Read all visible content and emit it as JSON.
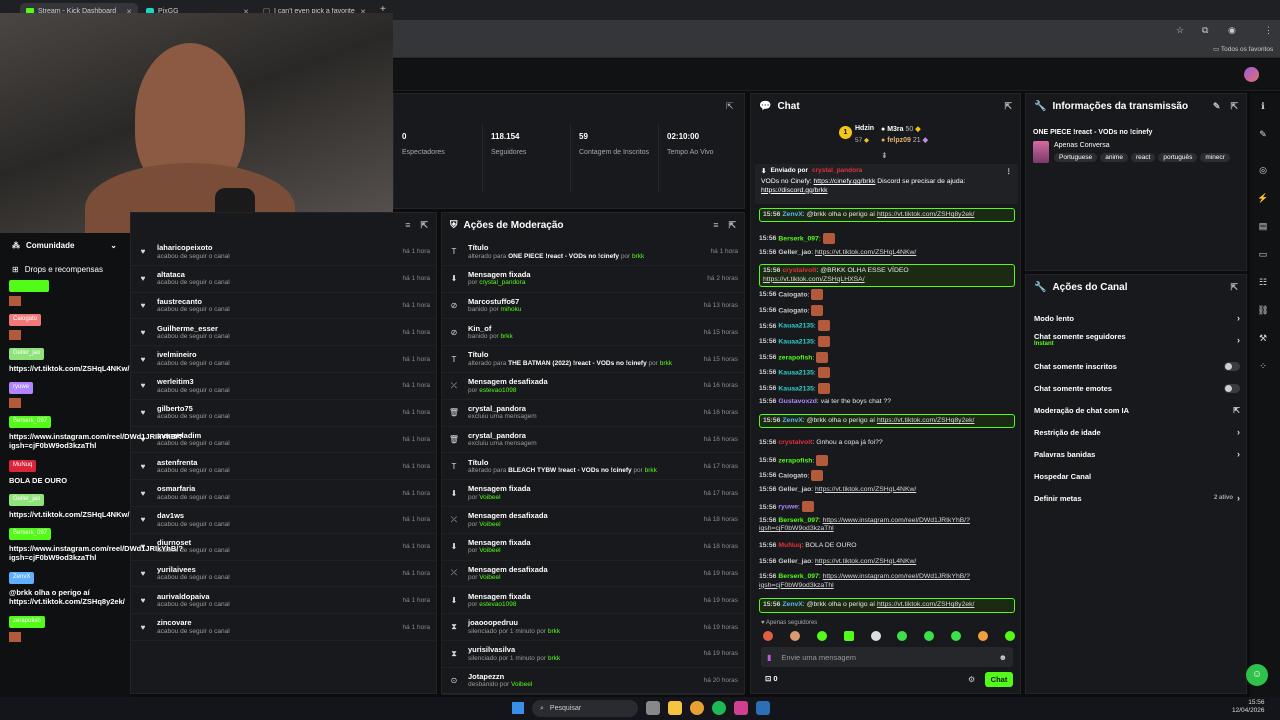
{
  "browser": {
    "tabs": [
      {
        "label": "Stream - Kick Dashboard",
        "active": true
      },
      {
        "label": "PixGG",
        "active": false
      },
      {
        "label": "I can't even pick a favorite her...",
        "active": false
      }
    ],
    "bookmarks_label": "Todos os favoritos"
  },
  "stats": [
    {
      "value": "0",
      "label": "Espectadores"
    },
    {
      "value": "118.154",
      "label": "Seguidores"
    },
    {
      "value": "59",
      "label": "Contagem de Inscritos"
    },
    {
      "value": "02:10:00",
      "label": "Tempo Ao Vivo"
    }
  ],
  "community": {
    "title": "Comunidade",
    "drops_label": "Drops e recompensas"
  },
  "followers": [
    {
      "name": "laharicopeixoto",
      "sub": "acabou de seguir o canal",
      "time": "há 1 hora"
    },
    {
      "name": "altataca",
      "sub": "acabou de seguir o canal",
      "time": "há 1 hora"
    },
    {
      "name": "faustrecanto",
      "sub": "acabou de seguir o canal",
      "time": "há 1 hora"
    },
    {
      "name": "Guilherme_esser",
      "sub": "acabou de seguir o canal",
      "time": "há 1 hora"
    },
    {
      "name": "ivelmineiro",
      "sub": "acabou de seguir o canal",
      "time": "há 1 hora"
    },
    {
      "name": "werleitim3",
      "sub": "acabou de seguir o canal",
      "time": "há 1 hora"
    },
    {
      "name": "gilberto75",
      "sub": "acabou de seguir o canal",
      "time": "há 1 hora"
    },
    {
      "name": "marmeladim",
      "sub": "acabou de seguir o canal",
      "time": "há 1 hora"
    },
    {
      "name": "astenfrenta",
      "sub": "acabou de seguir o canal",
      "time": "há 1 hora"
    },
    {
      "name": "osmarfaria",
      "sub": "acabou de seguir o canal",
      "time": "há 1 hora"
    },
    {
      "name": "dav1ws",
      "sub": "acabou de seguir o canal",
      "time": "há 1 hora"
    },
    {
      "name": "diurnoset",
      "sub": "acabou de seguir o canal",
      "time": "há 1 hora"
    },
    {
      "name": "yurilaivees",
      "sub": "acabou de seguir o canal",
      "time": "há 1 hora"
    },
    {
      "name": "aurivaldopaiva",
      "sub": "acabou de seguir o canal",
      "time": "há 1 hora"
    },
    {
      "name": "zincovare",
      "sub": "acabou de seguir o canal",
      "time": "há 1 hora"
    }
  ],
  "moderation": {
    "title": "Ações de Moderação",
    "rows": [
      {
        "icon": "T",
        "name": "Título",
        "pre": "alterado para ",
        "bold": "ONE PIECE !react - VODs no !cinefy",
        "by": "brkk",
        "time": "há 1 hora"
      },
      {
        "icon": "⬇",
        "name": "Mensagem fixada",
        "pre": "por ",
        "bold": "",
        "by": "crystal_pandora",
        "time": "há 2 horas"
      },
      {
        "icon": "⊘",
        "name": "Marcostuffo67",
        "pre": "banido por ",
        "bold": "",
        "by": "mihoku",
        "time": "há 13 horas"
      },
      {
        "icon": "⊘",
        "name": "Kin_of",
        "pre": "banido por ",
        "bold": "",
        "by": "brkk",
        "time": "há 15 horas"
      },
      {
        "icon": "T",
        "name": "Título",
        "pre": "alterado para ",
        "bold": "THE BATMAN (2022) !react - VODs no !cinefy",
        "by": "brkk",
        "time": "há 15 horas"
      },
      {
        "icon": "⤫",
        "name": "Mensagem desafixada",
        "pre": "por ",
        "bold": "",
        "by": "estevao1098",
        "time": "há 16 horas"
      },
      {
        "icon": "🗑",
        "name": "crystal_pandora",
        "pre": "excluiu uma mensagem",
        "bold": "",
        "by": "",
        "time": "há 16 horas"
      },
      {
        "icon": "🗑",
        "name": "crystal_pandora",
        "pre": "excluiu uma mensagem",
        "bold": "",
        "by": "",
        "time": "há 16 horas"
      },
      {
        "icon": "T",
        "name": "Título",
        "pre": "alterado para ",
        "bold": "BLEACH TYBW !react - VODs no !cinefy",
        "by": "brkk",
        "time": "há 17 horas"
      },
      {
        "icon": "⬇",
        "name": "Mensagem fixada",
        "pre": "por ",
        "bold": "",
        "by": "Voibeel",
        "time": "há 17 horas"
      },
      {
        "icon": "⤫",
        "name": "Mensagem desafixada",
        "pre": "por ",
        "bold": "",
        "by": "Voibeel",
        "time": "há 18 horas"
      },
      {
        "icon": "⬇",
        "name": "Mensagem fixada",
        "pre": "por ",
        "bold": "",
        "by": "Voibeel",
        "time": "há 18 horas"
      },
      {
        "icon": "⤫",
        "name": "Mensagem desafixada",
        "pre": "por ",
        "bold": "",
        "by": "Voibeel",
        "time": "há 19 horas"
      },
      {
        "icon": "⬇",
        "name": "Mensagem fixada",
        "pre": "por ",
        "bold": "",
        "by": "estevao1098",
        "time": "há 19 horas"
      },
      {
        "icon": "⧗",
        "name": "joaooopedruu",
        "pre": "silenciado por 1 minuto por ",
        "bold": "",
        "by": "brkk",
        "time": "há 19 horas"
      },
      {
        "icon": "⧗",
        "name": "yurisilvasilva",
        "pre": "silenciado por 1 minuto por ",
        "bold": "",
        "by": "brkk",
        "time": "há 19 horas"
      },
      {
        "icon": "⊙",
        "name": "Jotapezzn",
        "pre": "desbanido por ",
        "bold": "",
        "by": "Voibeel",
        "time": "há 20 horas"
      }
    ]
  },
  "chat": {
    "title": "Chat",
    "leaderboard": [
      {
        "name": "Hdzin",
        "points": "57"
      },
      {
        "name": "M3ra",
        "points": "50"
      },
      {
        "name": "felpz09",
        "points": "21"
      }
    ],
    "pinned": {
      "label": "Enviado por",
      "user": "crystal_pandora",
      "text": "VODs no Cinefy: ",
      "link1": "https://cinefy.gg/brkk",
      "text2": " Discord se precisar de ajuda: ",
      "link2": "https://discord.gg/brkk"
    },
    "messages": [
      {
        "time": "15:56",
        "user": "ZenvX",
        "color": "#5fb0ff",
        "text": "@brkk olha o perigo aí ",
        "link": "https://vt.tiktok.com/ZSHq8y2ek/",
        "hl": true
      },
      {
        "time": "15:56",
        "user": "Berserk_097",
        "color": "#53fc18",
        "text": "",
        "link": "",
        "hl": false
      },
      {
        "time": "15:56",
        "user": "Geller_jao",
        "color": "#cfcfcf",
        "text": "",
        "link": "https://vt.tiktok.com/ZSHqL4NKw/",
        "hl": false
      },
      {
        "time": "15:56",
        "user": "crystalvolt",
        "color": "#e0303a",
        "text": "@BRKK OLHA ESSE VÍDEO ",
        "link": "https://vt.tiktok.com/ZSHqLHXSA/",
        "hl": true
      },
      {
        "time": "15:56",
        "user": "Caiogato",
        "color": "#cfcfcf",
        "text": "",
        "link": "",
        "hl": false
      },
      {
        "time": "15:56",
        "user": "Caiogato",
        "color": "#cfcfcf",
        "text": "",
        "link": "",
        "hl": false
      },
      {
        "time": "15:56",
        "user": "Kauaa2135",
        "color": "#2fd0d0",
        "text": "",
        "link": "",
        "hl": false
      },
      {
        "time": "15:56",
        "user": "Kauaa2135",
        "color": "#2fd0d0",
        "text": "",
        "link": "",
        "hl": false
      },
      {
        "time": "15:56",
        "user": "zerapofish",
        "color": "#53fc18",
        "text": "",
        "link": "",
        "hl": false
      },
      {
        "time": "15:56",
        "user": "Kauaa2135",
        "color": "#2fd0d0",
        "text": "",
        "link": "",
        "hl": false
      },
      {
        "time": "15:56",
        "user": "Kauaa2135",
        "color": "#2fd0d0",
        "text": "",
        "link": "",
        "hl": false
      },
      {
        "time": "15:56",
        "user": "Gustavoxzd",
        "color": "#b085ff",
        "text": "vai ter the boys chat ??",
        "link": "",
        "hl": false
      },
      {
        "time": "15:56",
        "user": "ZenvX",
        "color": "#5fb0ff",
        "text": "@brkk olha o perigo aí ",
        "link": "https://vt.tiktok.com/ZSHq8y2ek/",
        "hl": true
      },
      {
        "time": "15:56",
        "user": "crystalvolt",
        "color": "#e0303a",
        "text": "Gnhou a copa já foi??",
        "link": "",
        "hl": false
      },
      {
        "time": "15:56",
        "user": "zerapofish",
        "color": "#53fc18",
        "text": "",
        "link": "",
        "hl": false
      },
      {
        "time": "15:56",
        "user": "Caiogato",
        "color": "#cfcfcf",
        "text": "",
        "link": "",
        "hl": false
      },
      {
        "time": "15:56",
        "user": "Geller_jao",
        "color": "#cfcfcf",
        "text": "",
        "link": "https://vt.tiktok.com/ZSHqL4NKw/",
        "hl": false
      },
      {
        "time": "15:56",
        "user": "ryuwe",
        "color": "#b085ff",
        "text": "",
        "link": "",
        "hl": false
      },
      {
        "time": "15:56",
        "user": "Berserk_097",
        "color": "#53fc18",
        "text": "",
        "link": "https://www.instagram.com/reel/DWd1JRIkYhB/?igsh=cjF0bW9od3kzaThl",
        "hl": false
      },
      {
        "time": "15:56",
        "user": "MuNuq",
        "color": "#e0303a",
        "text": "BOLA DE OURO",
        "link": "",
        "hl": false
      },
      {
        "time": "15:56",
        "user": "Geller_jao",
        "color": "#cfcfcf",
        "text": "",
        "link": "https://vt.tiktok.com/ZSHqL4NKw/",
        "hl": false
      },
      {
        "time": "15:56",
        "user": "Berserk_097",
        "color": "#53fc18",
        "text": "",
        "link": "https://www.instagram.com/reel/DWd1JRIkYhB/?igsh=cjF0bW9od3kzaThl",
        "hl": false
      },
      {
        "time": "15:56",
        "user": "ZenvX",
        "color": "#5fb0ff",
        "text": "@brkk olha o perigo aí ",
        "link": "https://vt.tiktok.com/ZSHq8y2ek/",
        "hl": true
      },
      {
        "time": "15:56",
        "user": "zerapofish",
        "color": "#53fc18",
        "text": "",
        "link": "",
        "hl": false
      }
    ],
    "followers_only": "Apenas seguidores",
    "input_placeholder": "Envie uma mensagem",
    "counter": "0",
    "send_label": "Chat"
  },
  "stream_info": {
    "title": "Informações da transmissão",
    "stream_title": "ONE PIECE !react - VODs no !cinefy",
    "category": "Apenas Conversa",
    "tags": [
      "Portuguese",
      "anime",
      "react",
      "português",
      "minecr"
    ]
  },
  "channel_actions": {
    "title": "Ações do Canal",
    "items": [
      {
        "label": "Modo lento",
        "sub": "",
        "control": "chevron"
      },
      {
        "label": "Chat somente seguidores",
        "sub": "Instant",
        "control": "chevron"
      },
      {
        "label": "Chat somente inscritos",
        "sub": "",
        "control": "toggle"
      },
      {
        "label": "Chat somente emotes",
        "sub": "",
        "control": "toggle"
      },
      {
        "label": "Moderação de chat com IA",
        "sub": "",
        "control": "external"
      },
      {
        "label": "Restrição de idade",
        "sub": "",
        "control": "chevron"
      },
      {
        "label": "Palavras banidas",
        "sub": "",
        "control": "chevron"
      },
      {
        "label": "Hospedar Canal",
        "sub": "",
        "control": "none"
      },
      {
        "label": "Definir metas",
        "sub": "",
        "control": "chevron",
        "badge": "2 ativo"
      }
    ]
  },
  "overlay_chat": [
    {
      "tag": "",
      "tag_color": "#53fc18",
      "msg": ""
    },
    {
      "tag": "Caiogato",
      "tag_color": "#f07a7a",
      "msg": ""
    },
    {
      "tag": "Geller_jao",
      "tag_color": "#8fe37a",
      "msg": "https://vt.tiktok.com/ZSHqL4NKw/"
    },
    {
      "tag": "ryuwe",
      "tag_color": "#b085ff",
      "msg": ""
    },
    {
      "tag": "Berserk_097",
      "tag_color": "#53fc18",
      "msg": "https://www.instagram.com/reel/DWd1JRIkYhB/?igsh=cjF0bW9od3kzaThl"
    },
    {
      "tag": "MuNuq",
      "tag_color": "#d9243a",
      "msg": "BOLA DE OURO"
    },
    {
      "tag": "Geller_jao",
      "tag_color": "#8fe37a",
      "msg": "https://vt.tiktok.com/ZSHqL4NKw/"
    },
    {
      "tag": "Berserk_097",
      "tag_color": "#53fc18",
      "msg": "https://www.instagram.com/reel/DWd1JRIkYhB/?igsh=cjF0bW9od3kzaThl"
    },
    {
      "tag": "ZenvX",
      "tag_color": "#5fb0ff",
      "msg": "@brkk olha o perigo aí https://vt.tiktok.com/ZSHq8y2ek/"
    },
    {
      "tag": "zerapofish",
      "tag_color": "#53fc18",
      "msg": ""
    }
  ],
  "taskbar": {
    "search": "Pesquisar",
    "time": "15:56",
    "date": "12/04/2026"
  },
  "colors": {
    "accent": "#53fc18",
    "panel": "#18191c",
    "bg": "#0b0c0d"
  }
}
